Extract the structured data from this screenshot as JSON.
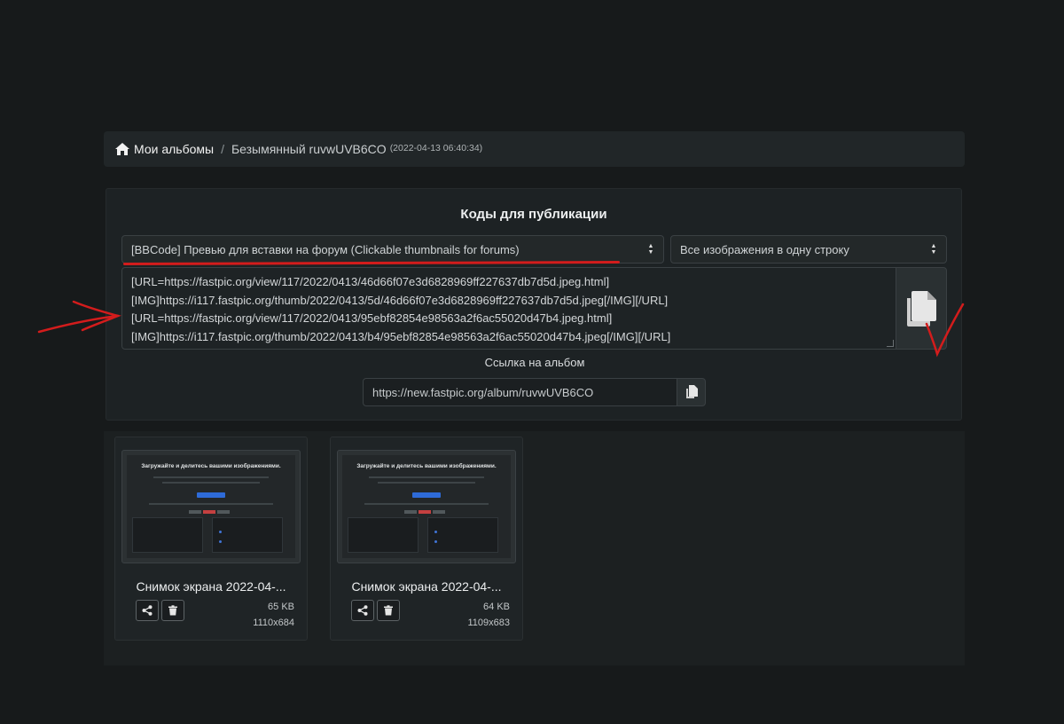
{
  "breadcrumb": {
    "home_label": "Мои альбомы",
    "separator": "/",
    "album_name": "Безымянный ruvwUVB6CO",
    "album_date": "(2022-04-13 06:40:34)"
  },
  "codes": {
    "title": "Коды для публикации",
    "format_select": "[BBCode] Превью для вставки на форум (Clickable thumbnails for forums)",
    "mode_select": "Все изображения в одну строку",
    "lines": [
      "[URL=https://fastpic.org/view/117/2022/0413/46d66f07e3d6828969ff227637db7d5d.jpeg.html]",
      "[IMG]https://i117.fastpic.org/thumb/2022/0413/5d/46d66f07e3d6828969ff227637db7d5d.jpeg[/IMG][/URL]",
      "[URL=https://fastpic.org/view/117/2022/0413/95ebf82854e98563a2f6ac55020d47b4.jpeg.html]",
      "[IMG]https://i117.fastpic.org/thumb/2022/0413/b4/95ebf82854e98563a2f6ac55020d47b4.jpeg[/IMG][/URL]"
    ],
    "album_link_label": "Ссылка на альбом",
    "album_link_value": "https://new.fastpic.org/album/ruvwUVB6CO"
  },
  "images": [
    {
      "name": "Снимок экрана 2022-04-...",
      "size": "65 KB",
      "dimensions": "1110x684",
      "thumb_title": "Загружайте и делитесь вашими изображениями."
    },
    {
      "name": "Снимок экрана 2022-04-...",
      "size": "64 KB",
      "dimensions": "1109x683",
      "thumb_title": "Загружайте и делитесь вашими изображениями."
    }
  ],
  "icons": {
    "home": "home-icon",
    "select_arrows": "sort-arrows-icon",
    "copy": "copy-icon",
    "share": "share-icon",
    "delete": "trash-icon"
  },
  "colors": {
    "background": "#171a1b",
    "panel": "#1d2224",
    "annotation_red": "#d31c1c",
    "accent_blue": "#2e6bd8"
  }
}
